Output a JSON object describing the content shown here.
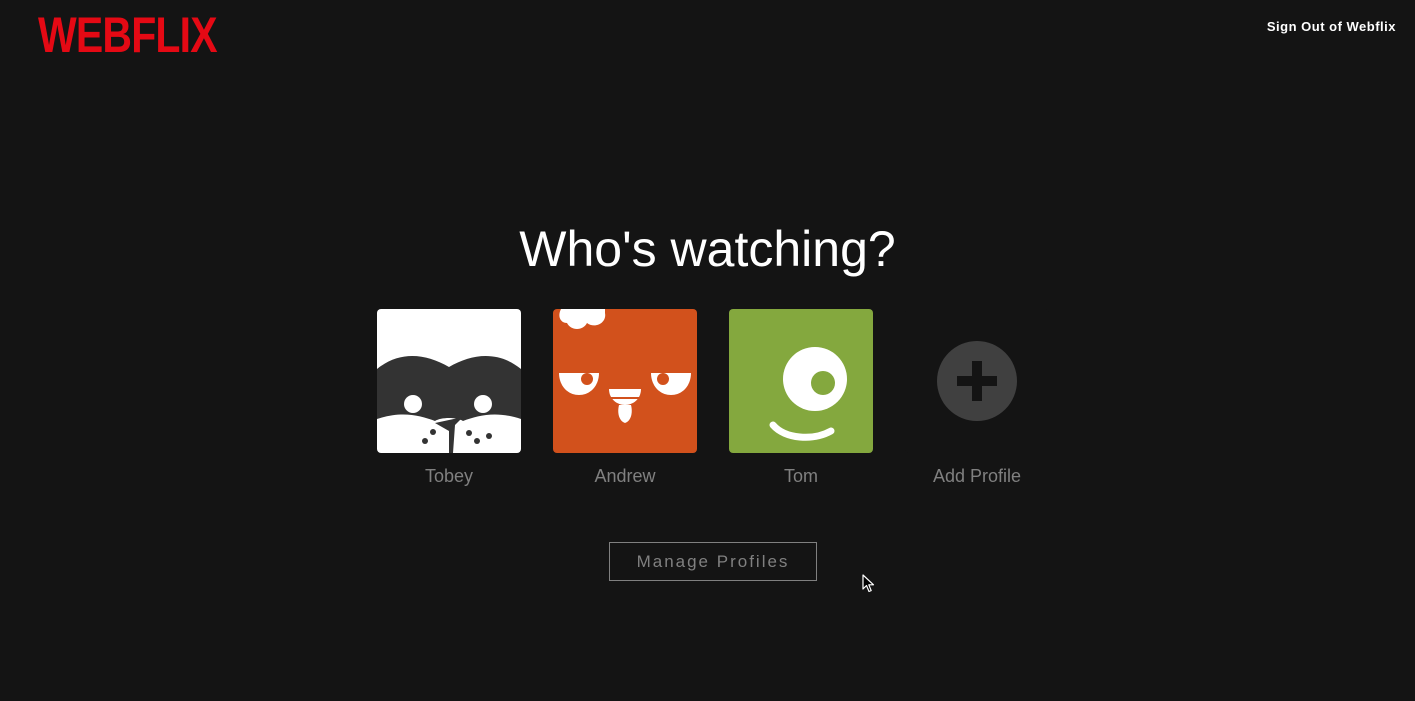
{
  "header": {
    "logo_text": "WEBFLIX",
    "sign_out_label": "Sign Out of Webflix"
  },
  "main": {
    "title": "Who's watching?",
    "profiles": [
      {
        "name": "Tobey",
        "avatar": "raccoon-mask-avatar",
        "color": "#ffffff"
      },
      {
        "name": "Andrew",
        "avatar": "chicken-face-avatar",
        "color": "#d2511c"
      },
      {
        "name": "Tom",
        "avatar": "one-eyed-smiley-avatar",
        "color": "#84a83e"
      },
      {
        "name": "Add Profile",
        "avatar": "plus-circle-icon",
        "color": "#404040"
      }
    ],
    "manage_profiles_label": "Manage Profiles"
  },
  "colors": {
    "background": "#141414",
    "brand_red": "#e50914",
    "muted_text": "#808080",
    "white": "#ffffff"
  }
}
